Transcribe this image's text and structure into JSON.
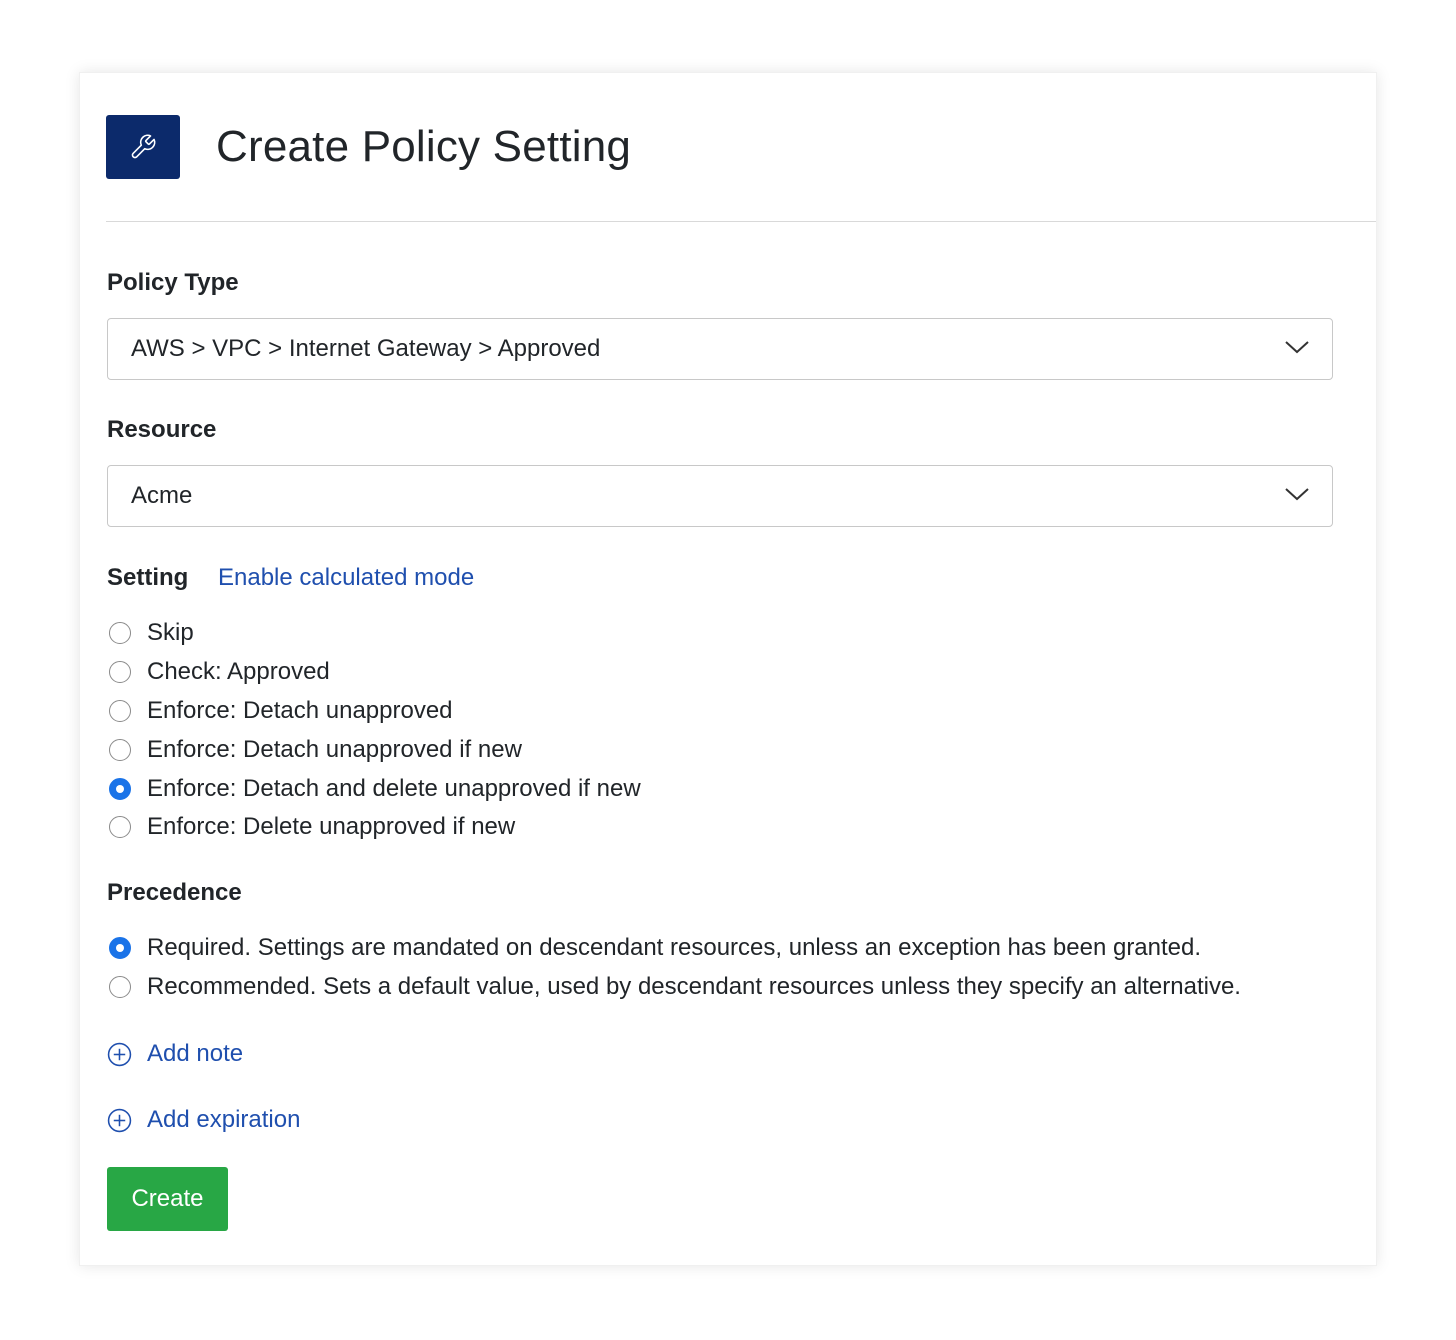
{
  "header": {
    "title": "Create Policy Setting",
    "icon": "wrench-icon",
    "icon_bg": "#0c2a6b"
  },
  "policy_type": {
    "label": "Policy Type",
    "value": "AWS > VPC > Internet Gateway > Approved"
  },
  "resource": {
    "label": "Resource",
    "value": "Acme"
  },
  "setting": {
    "label": "Setting",
    "link": "Enable calculated mode",
    "options": [
      {
        "label": "Skip",
        "checked": false
      },
      {
        "label": "Check: Approved",
        "checked": false
      },
      {
        "label": "Enforce: Detach unapproved",
        "checked": false
      },
      {
        "label": "Enforce: Detach unapproved if new",
        "checked": false
      },
      {
        "label": "Enforce: Detach and delete unapproved if new",
        "checked": true
      },
      {
        "label": "Enforce: Delete unapproved if new",
        "checked": false
      }
    ]
  },
  "precedence": {
    "label": "Precedence",
    "options": [
      {
        "label": "Required. Settings are mandated on descendant resources, unless an exception has been granted.",
        "checked": true
      },
      {
        "label": "Recommended. Sets a default value, used by descendant resources unless they specify an alternative.",
        "checked": false
      }
    ]
  },
  "actions": {
    "add_note": "Add note",
    "add_expiration": "Add expiration",
    "create": "Create"
  },
  "colors": {
    "link": "#1f4fae",
    "primary_radio": "#1a73e8",
    "create_button": "#28a745"
  }
}
